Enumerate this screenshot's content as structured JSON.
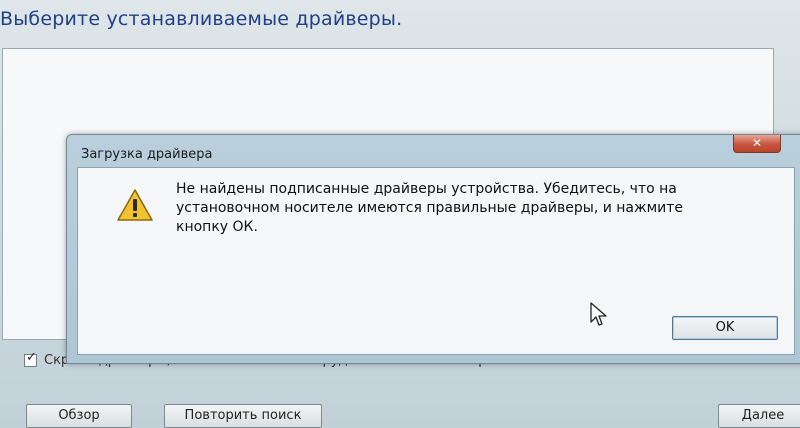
{
  "page": {
    "title": "Выберите устанавливаемые драйверы.",
    "hide_incompatible_label": "Скрыть драйверы, несовместимые с оборудованием компьютера.",
    "hide_incompatible_checked": true,
    "buttons": {
      "browse": "Обзор",
      "rescan": "Повторить поиск",
      "next": "Далее"
    }
  },
  "dialog": {
    "title": "Загрузка драйвера",
    "close_glyph": "✕",
    "message_lines": [
      "Не найдены подписанные драйверы устройства. Убедитесь, что на",
      "установочном носителе имеются правильные драйверы, и нажмите",
      "кнопку ОК."
    ],
    "ok_label": "OK",
    "icon": "warning-icon"
  },
  "colors": {
    "title_blue": "#1f3f86",
    "dialog_frame": "#b9cfdc",
    "close_red": "#c9553d",
    "warning_yellow": "#f2c230"
  }
}
